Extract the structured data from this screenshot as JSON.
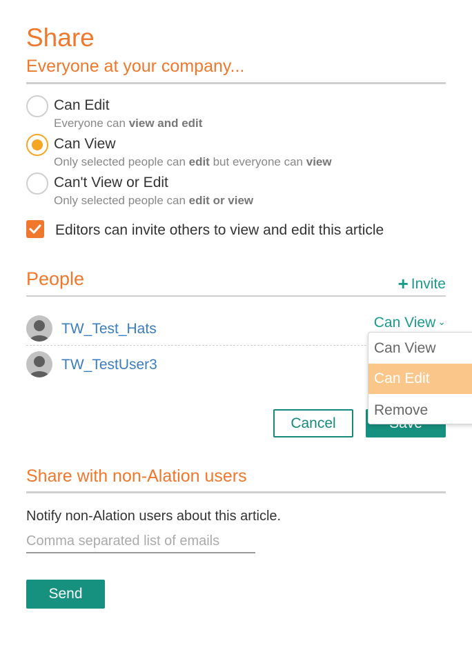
{
  "header": {
    "title": "Share",
    "subtitle": "Everyone at your company..."
  },
  "access_options": [
    {
      "label": "Can Edit",
      "desc_prefix": "Everyone can ",
      "desc_bold": "view and edit",
      "selected": false
    },
    {
      "label": "Can View",
      "desc_prefix": "Only selected people can ",
      "desc_bold": "edit",
      "desc_middle": " but everyone can ",
      "desc_bold2": "view",
      "selected": true
    },
    {
      "label": "Can't View or Edit",
      "desc_prefix": "Only selected people can ",
      "desc_bold": "edit or view",
      "selected": false
    }
  ],
  "editors_invite": {
    "label": "Editors can invite others to view and edit this article",
    "checked": true
  },
  "people": {
    "title": "People",
    "invite_label": "Invite",
    "members": [
      {
        "name": "TW_Test_Hats",
        "permission": "Can View"
      },
      {
        "name": "TW_TestUser3"
      }
    ],
    "dropdown_options": [
      "Can View",
      "Can Edit",
      "Remove"
    ],
    "dropdown_highlighted": "Can Edit"
  },
  "actions": {
    "cancel_label": "Cancel",
    "save_label": "Save"
  },
  "external": {
    "title": "Share with non-Alation users",
    "notify_text": "Notify non-Alation users about this article.",
    "email_placeholder": "Comma separated list of emails",
    "send_label": "Send"
  },
  "colors": {
    "accent_orange": "#f0782c",
    "teal": "#16907f",
    "link_blue": "#3a7dbf",
    "dropdown_highlight": "#fbc68a"
  }
}
